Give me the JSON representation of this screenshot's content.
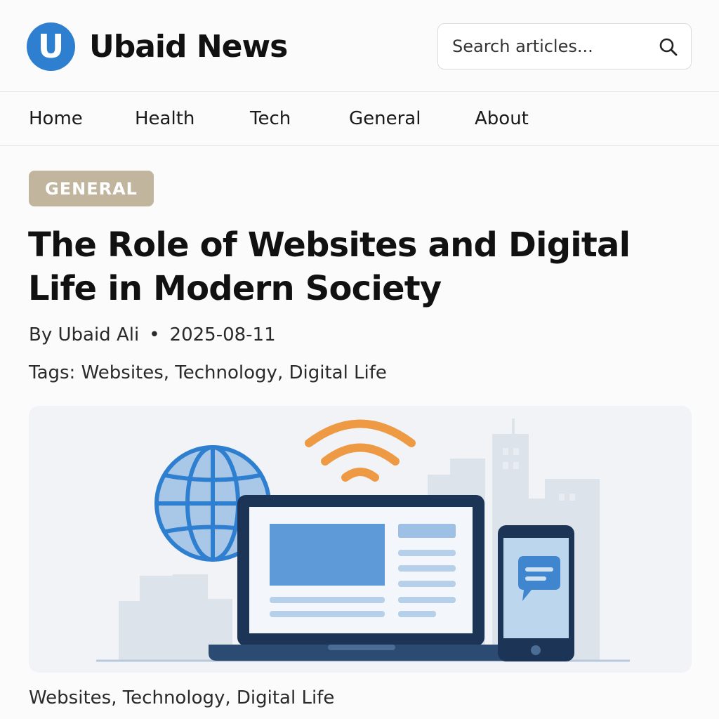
{
  "header": {
    "logo_letter": "U",
    "brand": "Ubaid News",
    "search": {
      "placeholder": "Search articles..."
    }
  },
  "nav": {
    "items": [
      "Home",
      "Health",
      "Tech",
      "General",
      "About"
    ]
  },
  "article": {
    "category": "GENERAL",
    "title": "The Role of Websites and Digital Life in Modern Society",
    "author": "By Ubaid Ali",
    "separator": "•",
    "date": "2025-08-11",
    "tags_line": "Tags: Websites, Technology, Digital Life",
    "footer_tags": "Websites, Technology, Digital Life"
  },
  "colors": {
    "brand_blue": "#2f7fd0",
    "badge": "#c2b59e",
    "wifi_orange": "#ee9a44",
    "device_navy": "#1c3556"
  },
  "icons": [
    "search-icon",
    "globe-icon",
    "wifi-icon",
    "laptop-icon",
    "smartphone-icon",
    "chat-bubble-icon"
  ]
}
